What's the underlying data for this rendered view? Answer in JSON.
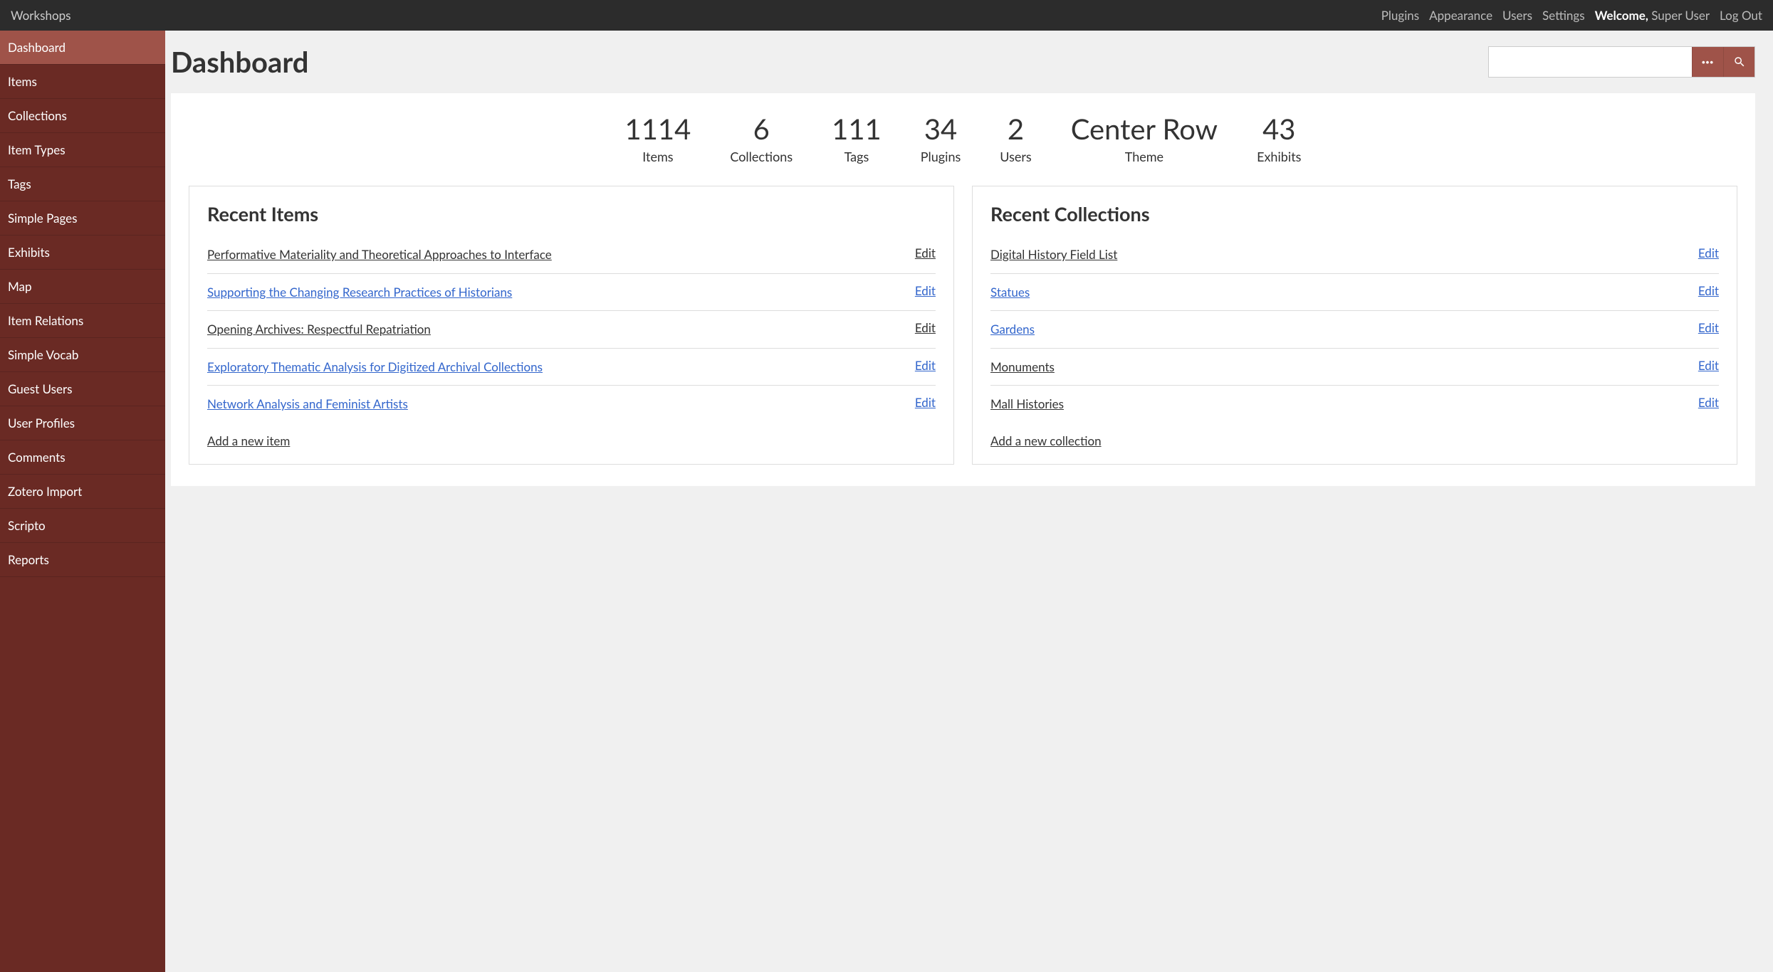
{
  "topbar": {
    "site_title": "Workshops",
    "links": [
      "Plugins",
      "Appearance",
      "Users",
      "Settings"
    ],
    "welcome_prefix": "Welcome,",
    "welcome_user": "Super User",
    "logout": "Log Out"
  },
  "sidebar": {
    "items": [
      {
        "label": "Dashboard",
        "active": true
      },
      {
        "label": "Items"
      },
      {
        "label": "Collections"
      },
      {
        "label": "Item Types"
      },
      {
        "label": "Tags"
      },
      {
        "label": "Simple Pages"
      },
      {
        "label": "Exhibits"
      },
      {
        "label": "Map"
      },
      {
        "label": "Item Relations"
      },
      {
        "label": "Simple Vocab"
      },
      {
        "label": "Guest Users"
      },
      {
        "label": "User Profiles"
      },
      {
        "label": "Comments"
      },
      {
        "label": "Zotero Import"
      },
      {
        "label": "Scripto"
      },
      {
        "label": "Reports"
      }
    ]
  },
  "page": {
    "title": "Dashboard"
  },
  "search": {
    "placeholder": ""
  },
  "stats": [
    {
      "value": "1114",
      "label": "Items"
    },
    {
      "value": "6",
      "label": "Collections"
    },
    {
      "value": "111",
      "label": "Tags"
    },
    {
      "value": "34",
      "label": "Plugins"
    },
    {
      "value": "2",
      "label": "Users"
    },
    {
      "value": "Center Row",
      "label": "Theme"
    },
    {
      "value": "43",
      "label": "Exhibits"
    }
  ],
  "recent_items": {
    "heading": "Recent Items",
    "rows": [
      {
        "title": "Performative Materiality and Theoretical Approaches to Interface",
        "edit": "Edit",
        "blue": false
      },
      {
        "title": "Supporting the Changing Research Practices of Historians",
        "edit": "Edit",
        "blue": true
      },
      {
        "title": "Opening Archives: Respectful Repatriation",
        "edit": "Edit",
        "blue": false
      },
      {
        "title": "Exploratory Thematic Analysis for Digitized Archival Collections",
        "edit": "Edit",
        "blue": true
      },
      {
        "title": "Network Analysis and Feminist Artists",
        "edit": "Edit",
        "blue": true
      }
    ],
    "add_link": "Add a new item"
  },
  "recent_collections": {
    "heading": "Recent Collections",
    "rows": [
      {
        "title": "Digital History Field List",
        "edit": "Edit",
        "title_blue": false,
        "edit_blue": true
      },
      {
        "title": "Statues",
        "edit": "Edit",
        "title_blue": true,
        "edit_blue": true
      },
      {
        "title": "Gardens",
        "edit": "Edit",
        "title_blue": true,
        "edit_blue": true
      },
      {
        "title": "Monuments",
        "edit": "Edit",
        "title_blue": false,
        "edit_blue": true
      },
      {
        "title": "Mall Histories",
        "edit": "Edit",
        "title_blue": false,
        "edit_blue": true
      }
    ],
    "add_link": "Add a new collection"
  }
}
